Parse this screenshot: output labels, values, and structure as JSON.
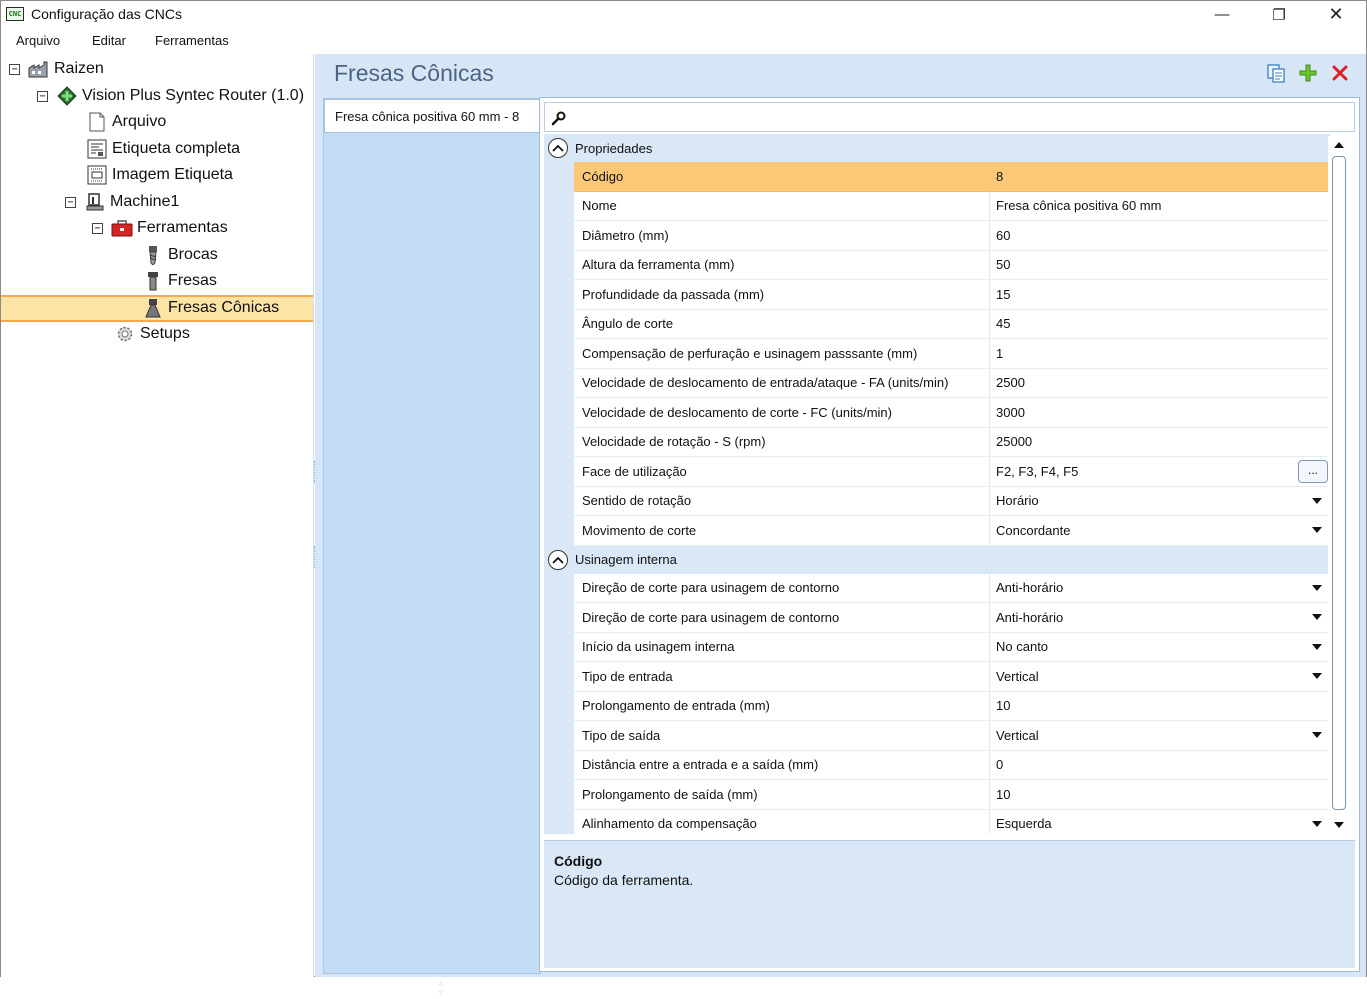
{
  "window": {
    "title": "Configuração das CNCs",
    "app_icon_text": "CNC",
    "controls": {
      "minimize": "—",
      "maximize": "❐",
      "close": "✕"
    }
  },
  "menu": [
    "Arquivo",
    "Editar",
    "Ferramentas"
  ],
  "tree": [
    {
      "label": "Raizen",
      "icon": "factory-icon",
      "expander": "⊟",
      "level": 0
    },
    {
      "label": "Vision Plus Syntec Router (1.0)",
      "icon": "router-icon",
      "expander": "⊟",
      "level": 1
    },
    {
      "label": "Arquivo",
      "icon": "file-icon",
      "expander": "",
      "level": 2
    },
    {
      "label": "Etiqueta completa",
      "icon": "label-icon",
      "expander": "",
      "level": 2
    },
    {
      "label": "Imagem Etiqueta",
      "icon": "image-label-icon",
      "expander": "",
      "level": 2
    },
    {
      "label": "Machine1",
      "icon": "machine-icon",
      "expander": "⊟",
      "level": 2
    },
    {
      "label": "Ferramentas",
      "icon": "toolbox-icon",
      "expander": "⊟",
      "level": 3
    },
    {
      "label": "Brocas",
      "icon": "drill-bit-icon",
      "expander": "",
      "level": 4
    },
    {
      "label": "Fresas",
      "icon": "mill-bit-icon",
      "expander": "",
      "level": 4
    },
    {
      "label": "Fresas Cônicas",
      "icon": "conical-bit-icon",
      "expander": "",
      "level": 4,
      "selected": true
    },
    {
      "label": "Setups",
      "icon": "gear-icon",
      "expander": "",
      "level": 3
    }
  ],
  "panel": {
    "title": "Fresas Cônicas",
    "toolbar": {
      "copy": "copy-icon",
      "add": "add-icon",
      "delete": "delete-icon"
    },
    "item_tab": "Fresa cônica positiva 60 mm - 8"
  },
  "grid": {
    "categories": [
      {
        "name": "Propriedades",
        "rows": [
          {
            "name": "Código",
            "value": "8",
            "selected": true
          },
          {
            "name": "Nome",
            "value": "Fresa cônica positiva 60 mm"
          },
          {
            "name": "Diâmetro (mm)",
            "value": "60"
          },
          {
            "name": "Altura da ferramenta (mm)",
            "value": "50"
          },
          {
            "name": "Profundidade da passada (mm)",
            "value": "15"
          },
          {
            "name": "Ângulo de corte",
            "value": "45"
          },
          {
            "name": "Compensação de perfuração e usinagem passsante (mm)",
            "value": "1"
          },
          {
            "name": "Velocidade de deslocamento de entrada/ataque - FA (units/min)",
            "value": "2500"
          },
          {
            "name": "Velocidade de deslocamento de corte - FC (units/min)",
            "value": "3000"
          },
          {
            "name": "Velocidade de rotação - S (rpm)",
            "value": "25000"
          },
          {
            "name": "Face de utilização",
            "value": "F2, F3, F4, F5",
            "editor": "ellipsis"
          },
          {
            "name": "Sentido de rotação",
            "value": "Horário",
            "editor": "dropdown"
          },
          {
            "name": "Movimento de corte",
            "value": "Concordante",
            "editor": "dropdown"
          }
        ]
      },
      {
        "name": "Usinagem interna",
        "rows": [
          {
            "name": "Direção de corte para usinagem de contorno",
            "value": "Anti-horário",
            "editor": "dropdown"
          },
          {
            "name": "Direção de corte para usinagem de contorno",
            "value": "Anti-horário",
            "editor": "dropdown"
          },
          {
            "name": "Início da usinagem interna",
            "value": "No canto",
            "editor": "dropdown"
          },
          {
            "name": "Tipo de entrada",
            "value": "Vertical",
            "editor": "dropdown"
          },
          {
            "name": "Prolongamento de entrada (mm)",
            "value": "10"
          },
          {
            "name": "Tipo de saída",
            "value": "Vertical",
            "editor": "dropdown"
          },
          {
            "name": "Distância entre a entrada e a saída (mm)",
            "value": "0"
          },
          {
            "name": "Prolongamento de saída (mm)",
            "value": "10"
          },
          {
            "name": "Alinhamento da compensação",
            "value": "Esquerda",
            "editor": "dropdown"
          }
        ]
      }
    ],
    "ellipsis_label": "..."
  },
  "description": {
    "title": "Código",
    "text": "Código da ferramenta."
  },
  "colors": {
    "selection": "#fbc877",
    "selection_border": "#f5a94b",
    "panel_bg": "#d7e6f7",
    "title_color": "#4d6382"
  }
}
